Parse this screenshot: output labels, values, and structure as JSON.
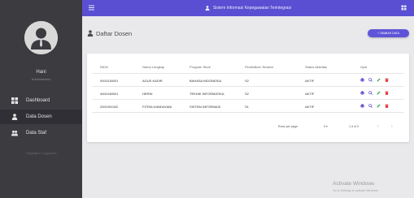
{
  "sidebar": {
    "user_name": "Hani",
    "user_role": "Administrator",
    "items": [
      {
        "label": "Dashboard",
        "icon": "dashboard-icon",
        "active": false
      },
      {
        "label": "Data Dosen",
        "icon": "person-icon",
        "active": true
      },
      {
        "label": "Data Staf",
        "icon": "people-icon",
        "active": false
      }
    ],
    "footer": "Copyright © yyyycom"
  },
  "topbar": {
    "title": "Sistem Informasi Kepegawaian Terintegrasi",
    "accent": "#5a4fd2"
  },
  "page": {
    "title": "Daftar Dosen",
    "add_button": "+ TAMBAH DATA"
  },
  "table": {
    "headers": [
      "NIDN",
      "Nama Lengkap",
      "Program Studi",
      "Pendidikan Terakhir",
      "Status Aktivitas",
      "Opsi"
    ],
    "rows": [
      [
        "0001018001",
        "AGUS KADIR",
        "BAHASA INDONESIA",
        "S2",
        "AKTIF"
      ],
      [
        "4001048001",
        "HERNI",
        "TEKNIK INFORMATIKA",
        "S2",
        "AKTIF"
      ],
      [
        "2001051002",
        "FITRIA HANDAYANI",
        "SISTEM INFORMASI",
        "S1",
        "AKTIF"
      ]
    ],
    "action_icons": [
      "print-icon",
      "search-icon",
      "edit-icon",
      "delete-icon"
    ]
  },
  "pager": {
    "rows_label": "Rows per page:",
    "rows_value": "5",
    "range": "1-3 of 3"
  },
  "watermark": {
    "title": "Activate Windows",
    "subtitle": "Go to Settings to activate Windows."
  }
}
